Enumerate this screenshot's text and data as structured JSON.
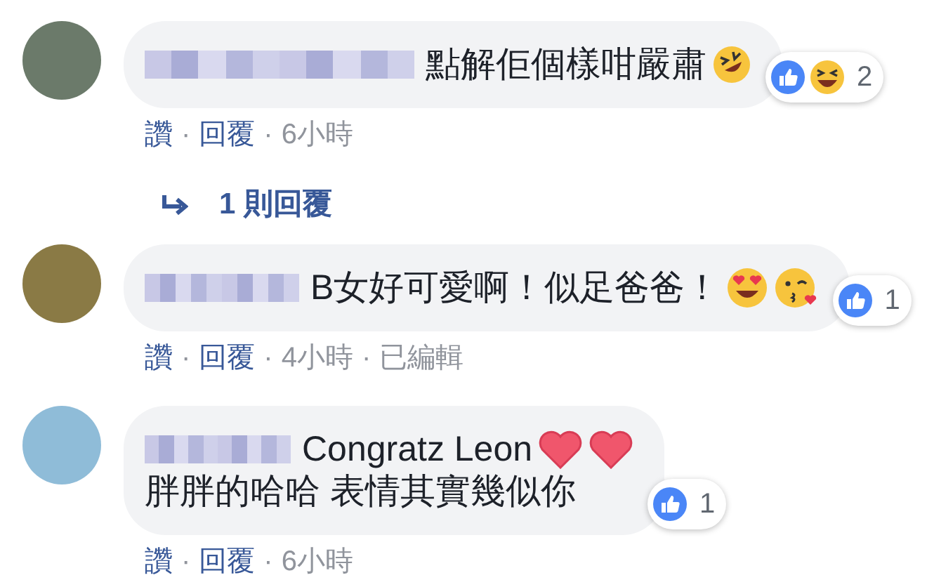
{
  "comments": [
    {
      "lines": [
        [
          {
            "kind": "text",
            "text": "點解佢個樣咁嚴肅"
          },
          {
            "kind": "rofl"
          }
        ]
      ],
      "reactions": {
        "icons": [
          {
            "kind": "like"
          },
          {
            "kind": "haha"
          }
        ],
        "count": "2"
      },
      "actions": [
        {
          "kind": "link",
          "text": "讚"
        },
        {
          "kind": "separator",
          "text": "·"
        },
        {
          "kind": "link",
          "text": "回覆"
        },
        {
          "kind": "separator",
          "text": "·"
        },
        {
          "kind": "time",
          "text": "6小時"
        }
      ],
      "replies": {
        "text": "1 則回覆"
      }
    },
    {
      "lines": [
        [
          {
            "kind": "text",
            "text": "B女好可愛啊！似足爸爸！"
          },
          {
            "kind": "heart_eyes"
          },
          {
            "kind": "kiss"
          }
        ]
      ],
      "reactions": {
        "icons": [
          {
            "kind": "like"
          }
        ],
        "count": "1"
      },
      "actions": [
        {
          "kind": "link",
          "text": "讚"
        },
        {
          "kind": "separator",
          "text": "·"
        },
        {
          "kind": "link",
          "text": "回覆"
        },
        {
          "kind": "separator",
          "text": "·"
        },
        {
          "kind": "time",
          "text": "4小時"
        },
        {
          "kind": "separator",
          "text": "·"
        },
        {
          "kind": "time",
          "text": "已編輯"
        }
      ]
    },
    {
      "lines": [
        [
          {
            "kind": "text",
            "text": "Congratz Leon"
          },
          {
            "kind": "heart"
          },
          {
            "kind": "heart"
          }
        ],
        [
          {
            "kind": "text",
            "text": "胖胖的哈哈 表情其實幾似你"
          }
        ]
      ],
      "reactions": {
        "icons": [
          {
            "kind": "like"
          }
        ],
        "count": "1"
      },
      "actions": [
        {
          "kind": "link",
          "text": "讚"
        },
        {
          "kind": "separator",
          "text": "·"
        },
        {
          "kind": "link",
          "text": "回覆"
        },
        {
          "kind": "separator",
          "text": "·"
        },
        {
          "kind": "time",
          "text": "6小時"
        }
      ]
    }
  ]
}
